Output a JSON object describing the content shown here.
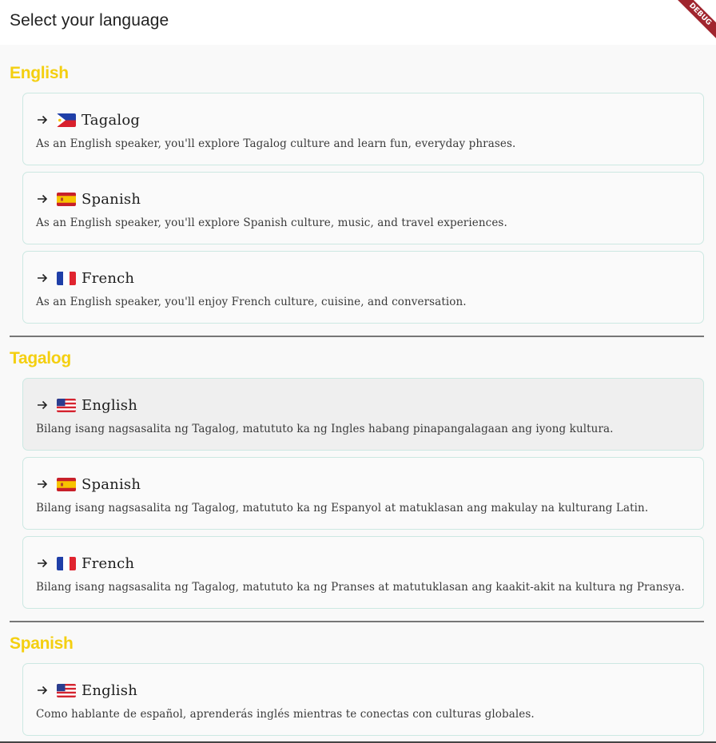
{
  "appbar": {
    "title": "Select your language",
    "debug_label": "DEBUG"
  },
  "sections": [
    {
      "title": "English",
      "items": [
        {
          "language": "Tagalog",
          "flag": "flag-philippines-icon",
          "description": "As an English speaker, you'll explore Tagalog culture and learn fun, everyday phrases."
        },
        {
          "language": "Spanish",
          "flag": "flag-spain-icon",
          "description": "As an English speaker, you'll explore Spanish culture, music, and travel experiences."
        },
        {
          "language": "French",
          "flag": "flag-france-icon",
          "description": "As an English speaker, you'll enjoy French culture, cuisine, and conversation."
        }
      ]
    },
    {
      "title": "Tagalog",
      "items": [
        {
          "language": "English",
          "flag": "flag-usa-icon",
          "description": "Bilang isang nagsasalita ng Tagalog, matututo ka ng Ingles habang pinapangalagaan ang iyong kultura."
        },
        {
          "language": "Spanish",
          "flag": "flag-spain-icon",
          "description": "Bilang isang nagsasalita ng Tagalog, matututo ka ng Espanyol at matuklasan ang makulay na kulturang Latin."
        },
        {
          "language": "French",
          "flag": "flag-france-icon",
          "description": "Bilang isang nagsasalita ng Tagalog, matututo ka ng Pranses at matutuklasan ang kaakit-akit na kultura ng Pransya."
        }
      ]
    },
    {
      "title": "Spanish",
      "items": [
        {
          "language": "English",
          "flag": "flag-usa-icon",
          "description": "Como hablante de español, aprenderás inglés mientras te conectas con culturas globales."
        }
      ]
    }
  ],
  "colors": {
    "section_title": "#f4cf10",
    "card_border": "#cce8e2",
    "card_hover_bg": "#efefef",
    "debug_ribbon": "#a0252e"
  }
}
